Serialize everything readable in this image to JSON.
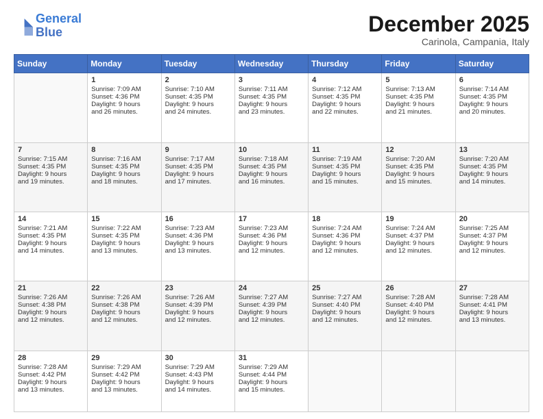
{
  "logo": {
    "line1": "General",
    "line2": "Blue"
  },
  "header": {
    "month": "December 2025",
    "location": "Carinola, Campania, Italy"
  },
  "weekdays": [
    "Sunday",
    "Monday",
    "Tuesday",
    "Wednesday",
    "Thursday",
    "Friday",
    "Saturday"
  ],
  "weeks": [
    [
      {
        "day": "",
        "info": ""
      },
      {
        "day": "1",
        "info": "Sunrise: 7:09 AM\nSunset: 4:36 PM\nDaylight: 9 hours\nand 26 minutes."
      },
      {
        "day": "2",
        "info": "Sunrise: 7:10 AM\nSunset: 4:35 PM\nDaylight: 9 hours\nand 24 minutes."
      },
      {
        "day": "3",
        "info": "Sunrise: 7:11 AM\nSunset: 4:35 PM\nDaylight: 9 hours\nand 23 minutes."
      },
      {
        "day": "4",
        "info": "Sunrise: 7:12 AM\nSunset: 4:35 PM\nDaylight: 9 hours\nand 22 minutes."
      },
      {
        "day": "5",
        "info": "Sunrise: 7:13 AM\nSunset: 4:35 PM\nDaylight: 9 hours\nand 21 minutes."
      },
      {
        "day": "6",
        "info": "Sunrise: 7:14 AM\nSunset: 4:35 PM\nDaylight: 9 hours\nand 20 minutes."
      }
    ],
    [
      {
        "day": "7",
        "info": "Sunrise: 7:15 AM\nSunset: 4:35 PM\nDaylight: 9 hours\nand 19 minutes."
      },
      {
        "day": "8",
        "info": "Sunrise: 7:16 AM\nSunset: 4:35 PM\nDaylight: 9 hours\nand 18 minutes."
      },
      {
        "day": "9",
        "info": "Sunrise: 7:17 AM\nSunset: 4:35 PM\nDaylight: 9 hours\nand 17 minutes."
      },
      {
        "day": "10",
        "info": "Sunrise: 7:18 AM\nSunset: 4:35 PM\nDaylight: 9 hours\nand 16 minutes."
      },
      {
        "day": "11",
        "info": "Sunrise: 7:19 AM\nSunset: 4:35 PM\nDaylight: 9 hours\nand 15 minutes."
      },
      {
        "day": "12",
        "info": "Sunrise: 7:20 AM\nSunset: 4:35 PM\nDaylight: 9 hours\nand 15 minutes."
      },
      {
        "day": "13",
        "info": "Sunrise: 7:20 AM\nSunset: 4:35 PM\nDaylight: 9 hours\nand 14 minutes."
      }
    ],
    [
      {
        "day": "14",
        "info": "Sunrise: 7:21 AM\nSunset: 4:35 PM\nDaylight: 9 hours\nand 14 minutes."
      },
      {
        "day": "15",
        "info": "Sunrise: 7:22 AM\nSunset: 4:35 PM\nDaylight: 9 hours\nand 13 minutes."
      },
      {
        "day": "16",
        "info": "Sunrise: 7:23 AM\nSunset: 4:36 PM\nDaylight: 9 hours\nand 13 minutes."
      },
      {
        "day": "17",
        "info": "Sunrise: 7:23 AM\nSunset: 4:36 PM\nDaylight: 9 hours\nand 12 minutes."
      },
      {
        "day": "18",
        "info": "Sunrise: 7:24 AM\nSunset: 4:36 PM\nDaylight: 9 hours\nand 12 minutes."
      },
      {
        "day": "19",
        "info": "Sunrise: 7:24 AM\nSunset: 4:37 PM\nDaylight: 9 hours\nand 12 minutes."
      },
      {
        "day": "20",
        "info": "Sunrise: 7:25 AM\nSunset: 4:37 PM\nDaylight: 9 hours\nand 12 minutes."
      }
    ],
    [
      {
        "day": "21",
        "info": "Sunrise: 7:26 AM\nSunset: 4:38 PM\nDaylight: 9 hours\nand 12 minutes."
      },
      {
        "day": "22",
        "info": "Sunrise: 7:26 AM\nSunset: 4:38 PM\nDaylight: 9 hours\nand 12 minutes."
      },
      {
        "day": "23",
        "info": "Sunrise: 7:26 AM\nSunset: 4:39 PM\nDaylight: 9 hours\nand 12 minutes."
      },
      {
        "day": "24",
        "info": "Sunrise: 7:27 AM\nSunset: 4:39 PM\nDaylight: 9 hours\nand 12 minutes."
      },
      {
        "day": "25",
        "info": "Sunrise: 7:27 AM\nSunset: 4:40 PM\nDaylight: 9 hours\nand 12 minutes."
      },
      {
        "day": "26",
        "info": "Sunrise: 7:28 AM\nSunset: 4:40 PM\nDaylight: 9 hours\nand 12 minutes."
      },
      {
        "day": "27",
        "info": "Sunrise: 7:28 AM\nSunset: 4:41 PM\nDaylight: 9 hours\nand 13 minutes."
      }
    ],
    [
      {
        "day": "28",
        "info": "Sunrise: 7:28 AM\nSunset: 4:42 PM\nDaylight: 9 hours\nand 13 minutes."
      },
      {
        "day": "29",
        "info": "Sunrise: 7:29 AM\nSunset: 4:42 PM\nDaylight: 9 hours\nand 13 minutes."
      },
      {
        "day": "30",
        "info": "Sunrise: 7:29 AM\nSunset: 4:43 PM\nDaylight: 9 hours\nand 14 minutes."
      },
      {
        "day": "31",
        "info": "Sunrise: 7:29 AM\nSunset: 4:44 PM\nDaylight: 9 hours\nand 15 minutes."
      },
      {
        "day": "",
        "info": ""
      },
      {
        "day": "",
        "info": ""
      },
      {
        "day": "",
        "info": ""
      }
    ]
  ]
}
